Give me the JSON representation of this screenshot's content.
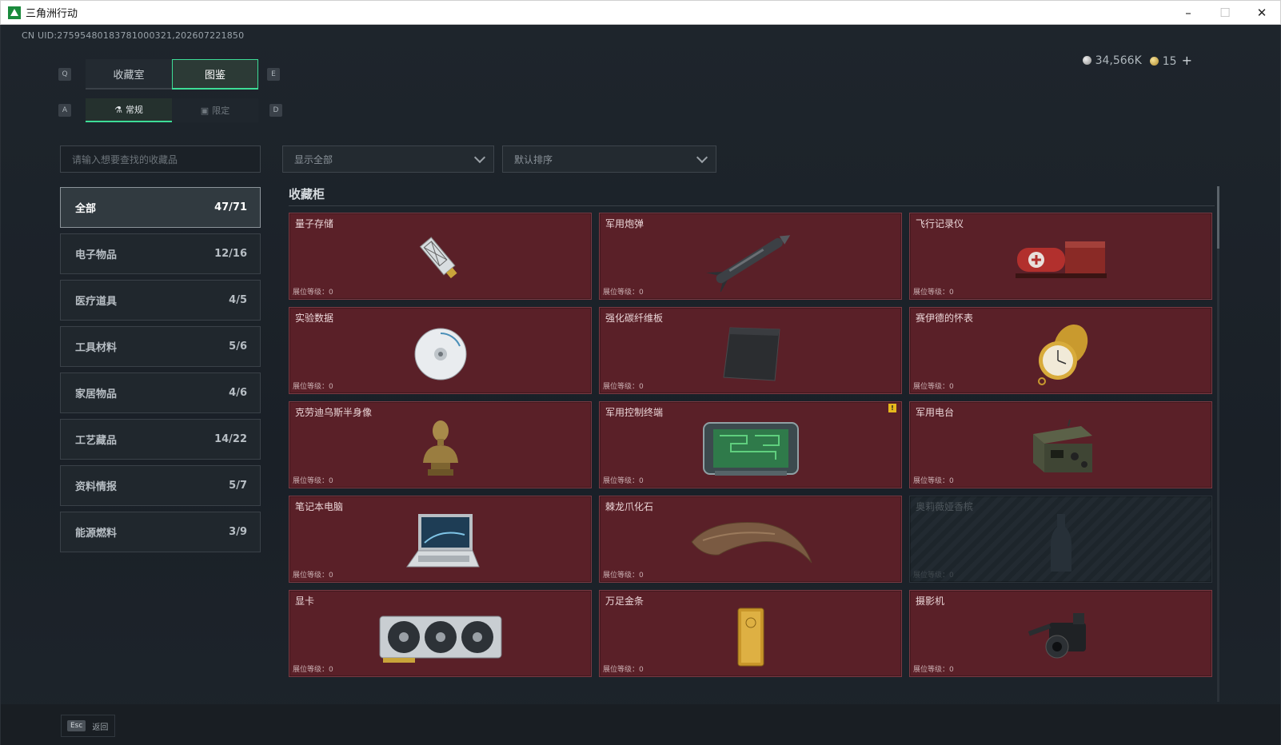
{
  "window": {
    "title": "三角洲行动",
    "minimize": "–",
    "maximize": "☐",
    "close": "✕"
  },
  "uid": "CN UID:27595480183781000321,202607221850",
  "currency": {
    "silver": "34,566K",
    "gold": "15",
    "plus": "+"
  },
  "keys": {
    "q": "Q",
    "e": "E",
    "a": "A",
    "d": "D"
  },
  "tabs_main": [
    {
      "label": "收藏室",
      "active": false
    },
    {
      "label": "图鉴",
      "active": true
    }
  ],
  "tabs_sub": [
    {
      "label": "常规",
      "active": true
    },
    {
      "label": "限定",
      "active": false
    }
  ],
  "search": {
    "placeholder": "请输入想要查找的收藏品"
  },
  "filters": {
    "show": "显示全部",
    "sort": "默认排序"
  },
  "categories": [
    {
      "label": "全部",
      "count": "47/71",
      "active": true
    },
    {
      "label": "电子物品",
      "count": "12/16"
    },
    {
      "label": "医疗道具",
      "count": "4/5"
    },
    {
      "label": "工具材料",
      "count": "5/6"
    },
    {
      "label": "家居物品",
      "count": "4/6"
    },
    {
      "label": "工艺藏品",
      "count": "14/22"
    },
    {
      "label": "资料情报",
      "count": "5/7"
    },
    {
      "label": "能源燃料",
      "count": "3/9"
    }
  ],
  "section_title": "收藏柜",
  "level_label": "展位等级：0",
  "items": [
    {
      "name": "量子存储",
      "icon": "usb-drive-icon"
    },
    {
      "name": "军用炮弹",
      "icon": "missile-icon"
    },
    {
      "name": "飞行记录仪",
      "icon": "flight-recorder-icon"
    },
    {
      "name": "实验数据",
      "icon": "disc-icon"
    },
    {
      "name": "强化碳纤维板",
      "icon": "carbon-plate-icon"
    },
    {
      "name": "赛伊德的怀表",
      "icon": "pocket-watch-icon"
    },
    {
      "name": "克劳迪乌斯半身像",
      "icon": "bust-icon"
    },
    {
      "name": "军用控制终端",
      "icon": "control-terminal-icon",
      "alert": "!"
    },
    {
      "name": "军用电台",
      "icon": "radio-icon"
    },
    {
      "name": "笔记本电脑",
      "icon": "laptop-icon"
    },
    {
      "name": "棘龙爪化石",
      "icon": "claw-fossil-icon"
    },
    {
      "name": "奥莉薇娅香槟",
      "icon": "champagne-icon",
      "locked": true
    },
    {
      "name": "显卡",
      "icon": "gpu-icon"
    },
    {
      "name": "万足金条",
      "icon": "gold-bar-icon"
    },
    {
      "name": "摄影机",
      "icon": "camera-icon"
    }
  ],
  "footer": {
    "esc_key": "Esc",
    "esc_label": "返回"
  }
}
